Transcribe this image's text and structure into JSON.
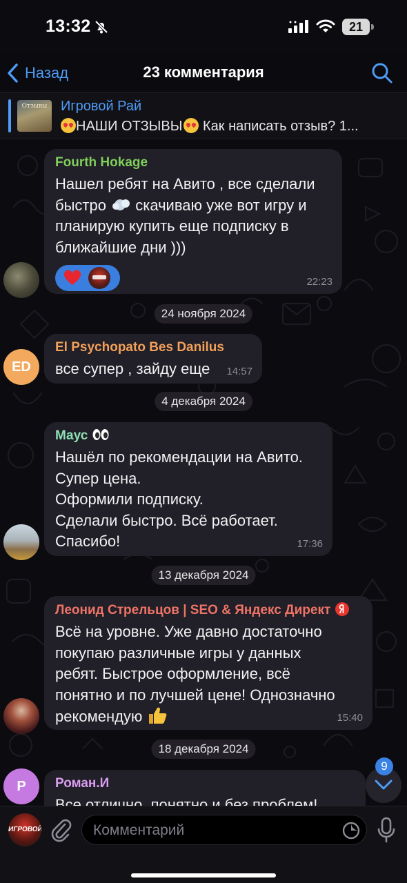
{
  "status_bar": {
    "time": "13:32",
    "battery": "21"
  },
  "header": {
    "back_label": "Назад",
    "title": "23 комментария"
  },
  "pinned": {
    "thumb_text": "Отзывы",
    "channel_name": "Игровой Рай",
    "text": "НАШИ ОТЗЫВЫ",
    "text_rest": " Как написать отзыв? 1..."
  },
  "messages": [
    {
      "sender": "Fourth Hokage",
      "sender_color": "#7fcf5b",
      "lines": [
        "Нашел ребят на Авито , все сделали",
        "быстро",
        "скачиваю уже вот игру и",
        "планирую купить еще подписку в",
        "ближайшие дни )))"
      ],
      "time": "22:23",
      "reactions": [
        "heart",
        "channel-avatar"
      ]
    },
    {
      "sender": "El Psychopato Bes Danilus",
      "sender_color": "#f3a05a",
      "avatar_initials": "ED",
      "avatar_color": "#f3a95e",
      "lines": [
        "все супер , зайду еще"
      ],
      "time": "14:57"
    },
    {
      "sender": "Маус",
      "sender_color": "#8ee0b4",
      "lines": [
        "Нашёл по рекомендации на Авито.",
        "Супер цена.",
        "Оформили подписку.",
        "Сделали быстро. Всё работает.",
        "Спасибо!"
      ],
      "time": "17:36"
    },
    {
      "sender": "Леонид Стрельцов | SEO & Яндекс Директ",
      "sender_color": "#ef7467",
      "lines": [
        "Всё на уровне. Уже давно достаточно",
        "покупаю различные игры у данных",
        "ребят. Быстрое оформление, всё",
        "понятно и по лучшей цене! Однозначно",
        "рекомендую"
      ],
      "time": "15:40"
    },
    {
      "sender": "Роман.И",
      "sender_color": "#d89cf0",
      "avatar_initials": "Р",
      "avatar_color": "#c47ae0",
      "lines": [
        "Все отлично, понятно и без проблем!"
      ]
    }
  ],
  "dates": [
    "24 ноября 2024",
    "4 декабря 2024",
    "13 декабря 2024",
    "18 декабря 2024"
  ],
  "scroll": {
    "unread_count": "9"
  },
  "composer": {
    "placeholder": "Комментарий",
    "send_as_label": "ИГРОВОЙ"
  },
  "colors": {
    "accent": "#4e9cf5",
    "bubble": "#211f27",
    "background": "#0c0b0f"
  }
}
